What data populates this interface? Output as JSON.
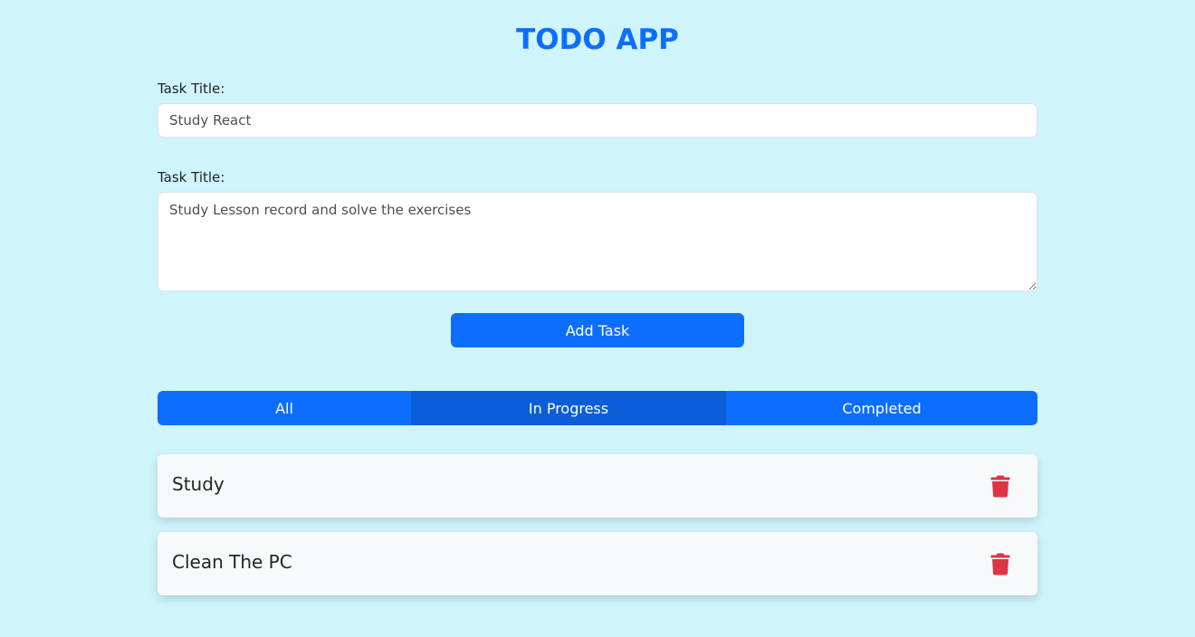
{
  "app": {
    "title": "TODO APP"
  },
  "form": {
    "title_label": "Task Title:",
    "title_value": "Study React",
    "description_label": "Task Title:",
    "description_value": "Study Lesson record and solve the exercises",
    "add_button_label": "Add Task"
  },
  "filters": {
    "active": "In Progress",
    "items": [
      {
        "label": "All"
      },
      {
        "label": "In Progress"
      },
      {
        "label": "Completed"
      }
    ]
  },
  "tasks": [
    {
      "title": "Study"
    },
    {
      "title": "Clean The PC"
    }
  ],
  "icons": {
    "delete": "trash-icon"
  },
  "colors": {
    "background": "#cff4fc",
    "primary": "#0d6efd",
    "primary_active": "#0b5ed7",
    "danger": "#dc3545",
    "card": "#f8f9fa"
  }
}
